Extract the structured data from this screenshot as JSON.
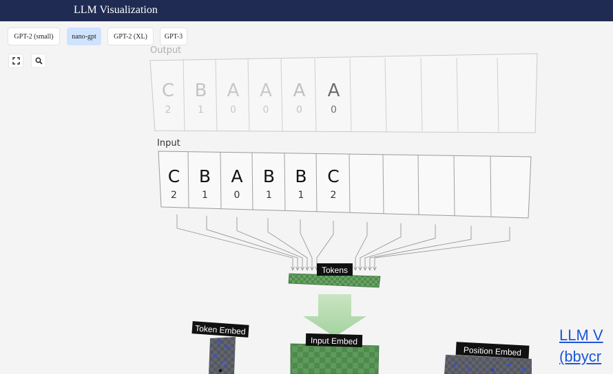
{
  "app": {
    "title": "LLM Visualization"
  },
  "models": [
    {
      "label": "GPT-2 (small)",
      "active": false
    },
    {
      "label": "nano-gpt",
      "active": true
    },
    {
      "label": "GPT-2 (XL)",
      "active": false
    },
    {
      "label": "GPT-3",
      "active": false
    }
  ],
  "tools": {
    "expand_icon": "expand-icon",
    "search_icon": "search-icon"
  },
  "output": {
    "label": "Output",
    "cells": [
      {
        "letter": "C",
        "index": "2"
      },
      {
        "letter": "B",
        "index": "1"
      },
      {
        "letter": "A",
        "index": "0"
      },
      {
        "letter": "A",
        "index": "0"
      },
      {
        "letter": "A",
        "index": "0"
      },
      {
        "letter": "A",
        "index": "0"
      }
    ]
  },
  "input": {
    "label": "Input",
    "cells": [
      {
        "letter": "C",
        "index": "2"
      },
      {
        "letter": "B",
        "index": "1"
      },
      {
        "letter": "A",
        "index": "0"
      },
      {
        "letter": "B",
        "index": "1"
      },
      {
        "letter": "B",
        "index": "1"
      },
      {
        "letter": "C",
        "index": "2"
      }
    ]
  },
  "blocks": {
    "tokens": "Tokens",
    "token_embed": "Token Embed",
    "input_embed": "Input Embed",
    "position_embed": "Position Embed"
  },
  "side_link": {
    "line1": "LLM V",
    "line2": "(bbycr"
  },
  "colors": {
    "topbar": "#1f2b52",
    "active": "#cfe3ff",
    "green": "#4e8a4c",
    "link": "#1a56d8"
  }
}
